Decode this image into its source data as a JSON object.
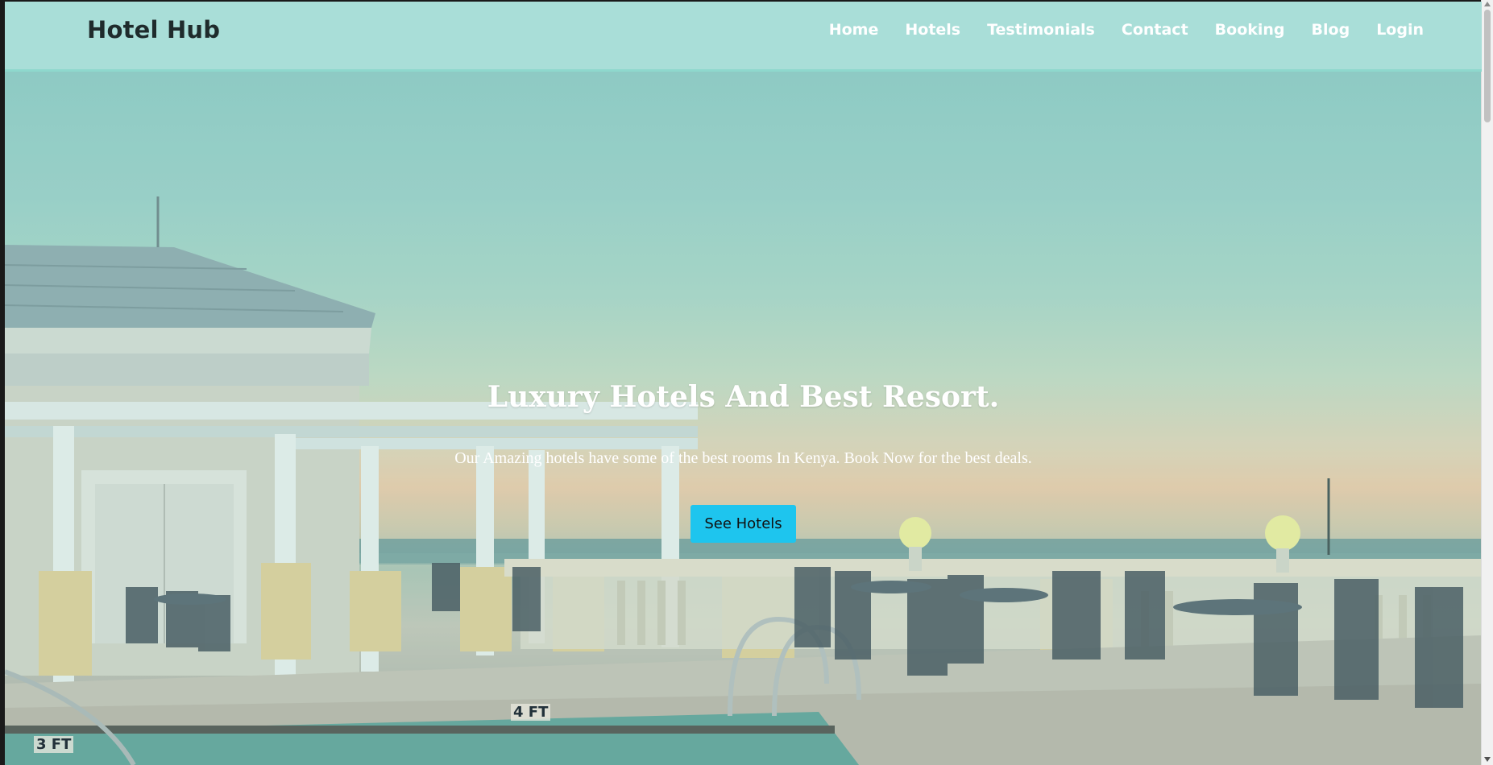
{
  "navbar": {
    "brand": "Hotel Hub",
    "links": [
      {
        "label": "Home"
      },
      {
        "label": "Hotels"
      },
      {
        "label": "Testimonials"
      },
      {
        "label": "Contact"
      },
      {
        "label": "Booking"
      },
      {
        "label": "Blog"
      },
      {
        "label": "Login"
      }
    ]
  },
  "hero": {
    "title": "Luxury Hotels And Best Resort.",
    "subtitle": "Our Amazing hotels have some of the best rooms In Kenya. Book Now for the best deals.",
    "button_label": "See Hotels",
    "pool_markers": [
      "3 FT",
      "4 FT"
    ]
  },
  "colors": {
    "navbar_bg": "#a9ded8",
    "brand_text": "#1f2b2c",
    "nav_link": "#ffffff",
    "button_bg": "#1ec5ee"
  }
}
